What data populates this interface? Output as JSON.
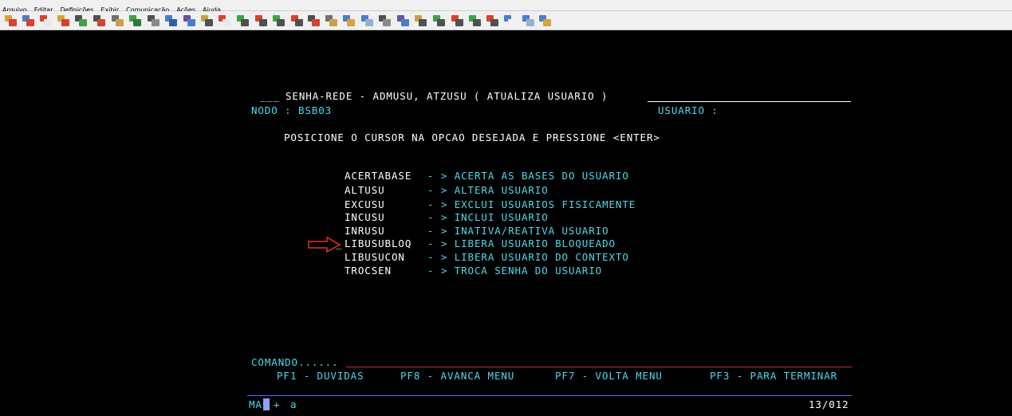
{
  "menubar": {
    "items": [
      "Arquivo",
      "Editar",
      "Definições",
      "Exibir",
      "Comunicação",
      "Ações",
      "Ajuda"
    ]
  },
  "toolbar": {
    "icons": [
      "connect-icon",
      "disconnect-icon",
      "exit-icon",
      "connect-icon",
      "send-file-icon",
      "receive-file-icon",
      "copy-icon",
      "paste-icon",
      "print-icon",
      "transfer-icon",
      "keyboard-icon",
      "macro-icon",
      "exit-icon",
      "send-icon",
      "receive-icon",
      "send-icon",
      "receive-icon",
      "file-icon",
      "copy-icon",
      "record-icon",
      "play-icon",
      "print-icon",
      "keyboard-icon",
      "macro-icon",
      "send-icon",
      "receive-icon",
      "send-icon",
      "receive-icon",
      "link-icon",
      "play-icon",
      "record-icon"
    ]
  },
  "screen": {
    "header_prefix": "___",
    "title": "SENHA-REDE - ADMUSU, ATZUSU ( ATUALIZA USUARIO )",
    "nodo_label": "NODO : BSB03",
    "usuario_label": "USUARIO :",
    "instruction": "POSICIONE O CURSOR NA OPCAO DESEJADA E PRESSIONE <ENTER>",
    "options": [
      {
        "code": "ACERTABASE",
        "desc": "- > ACERTA AS BASES DO USUARIO"
      },
      {
        "code": "ALTUSU",
        "desc": "- > ALTERA USUARIO"
      },
      {
        "code": "EXCUSU",
        "desc": "- > EXCLUI USUARIOS FISICAMENTE"
      },
      {
        "code": "INCUSU",
        "desc": "- > INCLUI USUARIO"
      },
      {
        "code": "INRUSU",
        "desc": "- > INATIVA/REATIVA USUARIO"
      },
      {
        "code": "LIBUSUBLOQ",
        "desc": "- > LIBERA USUARIO BLOQUEADO"
      },
      {
        "code": "LIBUSUCON",
        "desc": "- > LIBERA USUARIO DO CONTEXTO"
      },
      {
        "code": "TROCSEN",
        "desc": "- > TROCA SENHA DO USUARIO"
      }
    ],
    "cursor_mark": "_",
    "comando_label": "COMANDO......",
    "pf_keys": [
      "PF1 - DUVIDAS",
      "PF8 - AVANCA MENU",
      "PF7 - VOLTA MENU",
      "PF3 - PARA TERMINAR"
    ]
  },
  "statusbar": {
    "mode": "MA",
    "indicator": "+",
    "session": "a",
    "cursor_position": "13/012"
  },
  "colors": {
    "background": "#000000",
    "text_white": "#ffffff",
    "text_cyan": "#4dd9ea",
    "rule_red": "#c0392b",
    "rule_blue": "#5a6cff",
    "annotation_arrow": "#e0302a"
  }
}
